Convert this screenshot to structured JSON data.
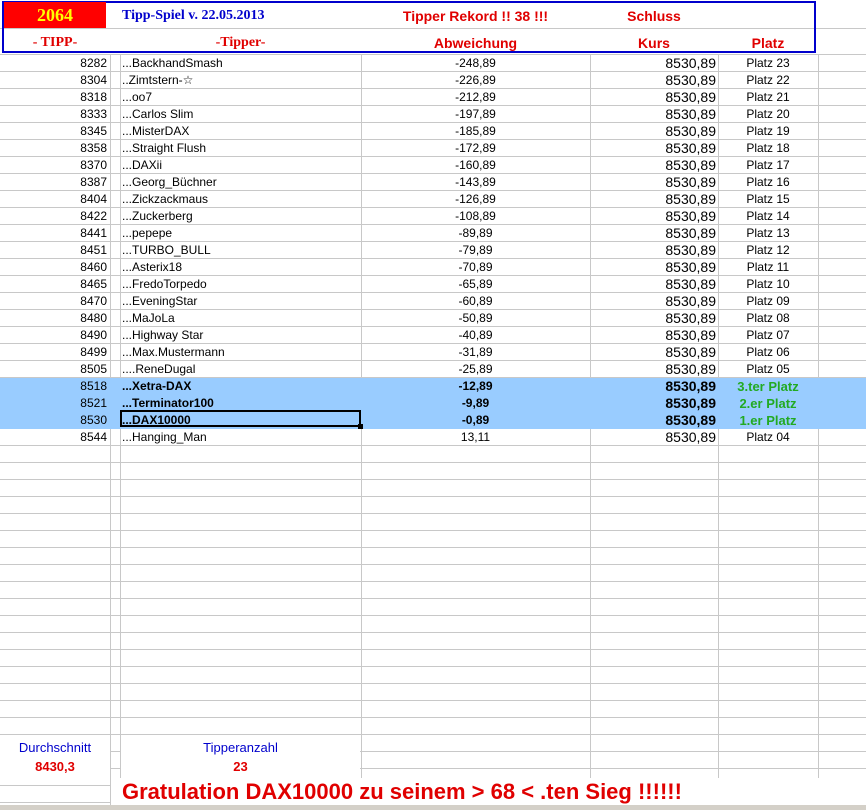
{
  "header": {
    "tipp_count": "2064",
    "title": "Tipp-Spiel v. 22.05.2013",
    "rekord": "Tipper Rekord !!  38  !!!",
    "schluss": "Schluss",
    "col_tipp": "- TIPP-",
    "col_tipper": "-Tipper-",
    "col_abweichung": "Abweichung",
    "col_kurs": "Kurs",
    "col_platz": "Platz"
  },
  "rows": [
    {
      "tipp": "8282",
      "tipper": "...BackhandSmash",
      "abw": "-248,89",
      "kurs": "8530,89",
      "platz": "Platz 23"
    },
    {
      "tipp": "8304",
      "tipper": "..Zimtstern-☆",
      "abw": "-226,89",
      "kurs": "8530,89",
      "platz": "Platz 22"
    },
    {
      "tipp": "8318",
      "tipper": "...oo7",
      "abw": "-212,89",
      "kurs": "8530,89",
      "platz": "Platz 21"
    },
    {
      "tipp": "8333",
      "tipper": "...Carlos Slim",
      "abw": "-197,89",
      "kurs": "8530,89",
      "platz": "Platz 20"
    },
    {
      "tipp": "8345",
      "tipper": "...MisterDAX",
      "abw": "-185,89",
      "kurs": "8530,89",
      "platz": "Platz 19"
    },
    {
      "tipp": "8358",
      "tipper": "...Straight Flush",
      "abw": "-172,89",
      "kurs": "8530,89",
      "platz": "Platz 18"
    },
    {
      "tipp": "8370",
      "tipper": "...DAXii",
      "abw": "-160,89",
      "kurs": "8530,89",
      "platz": "Platz 17"
    },
    {
      "tipp": "8387",
      "tipper": "...Georg_Büchner",
      "abw": "-143,89",
      "kurs": "8530,89",
      "platz": "Platz 16"
    },
    {
      "tipp": "8404",
      "tipper": "...Zickzackmaus",
      "abw": "-126,89",
      "kurs": "8530,89",
      "platz": "Platz 15"
    },
    {
      "tipp": "8422",
      "tipper": "...Zuckerberg",
      "abw": "-108,89",
      "kurs": "8530,89",
      "platz": "Platz 14"
    },
    {
      "tipp": "8441",
      "tipper": "...pepepe",
      "abw": "-89,89",
      "kurs": "8530,89",
      "platz": "Platz 13"
    },
    {
      "tipp": "8451",
      "tipper": "...TURBO_BULL",
      "abw": "-79,89",
      "kurs": "8530,89",
      "platz": "Platz 12"
    },
    {
      "tipp": "8460",
      "tipper": "...Asterix18",
      "abw": "-70,89",
      "kurs": "8530,89",
      "platz": "Platz 11"
    },
    {
      "tipp": "8465",
      "tipper": "...FredoTorpedo",
      "abw": "-65,89",
      "kurs": "8530,89",
      "platz": "Platz 10"
    },
    {
      "tipp": "8470",
      "tipper": "...EveningStar",
      "abw": "-60,89",
      "kurs": "8530,89",
      "platz": "Platz 09"
    },
    {
      "tipp": "8480",
      "tipper": "...MaJoLa",
      "abw": "-50,89",
      "kurs": "8530,89",
      "platz": "Platz 08"
    },
    {
      "tipp": "8490",
      "tipper": "...Highway Star",
      "abw": "-40,89",
      "kurs": "8530,89",
      "platz": "Platz 07"
    },
    {
      "tipp": "8499",
      "tipper": "...Max.Mustermann",
      "abw": "-31,89",
      "kurs": "8530,89",
      "platz": "Platz 06"
    },
    {
      "tipp": "8505",
      "tipper": "....ReneDugal",
      "abw": "-25,89",
      "kurs": "8530,89",
      "platz": "Platz 05"
    },
    {
      "tipp": "8518",
      "tipper": "...Xetra-DAX",
      "abw": "-12,89",
      "kurs": "8530,89",
      "platz": "3.ter Platz",
      "hl": true
    },
    {
      "tipp": "8521",
      "tipper": "...Terminator100",
      "abw": "-9,89",
      "kurs": "8530,89",
      "platz": "2.er Platz",
      "hl": true
    },
    {
      "tipp": "8530",
      "tipper": "...DAX10000",
      "abw": "-0,89",
      "kurs": "8530,89",
      "platz": "1.er Platz",
      "hl": true
    },
    {
      "tipp": "8544",
      "tipper": "...Hanging_Man",
      "abw": "13,11",
      "kurs": "8530,89",
      "platz": "Platz 04"
    }
  ],
  "footer": {
    "durchschnitt_label": "Durchschnitt",
    "durchschnitt": "8430,3",
    "tipperanzahl_label": "Tipperanzahl",
    "tipperanzahl": "23",
    "gratulation": "Gratulation DAX10000 zu seinem > 68 < .ten Sieg !!!!!!"
  }
}
